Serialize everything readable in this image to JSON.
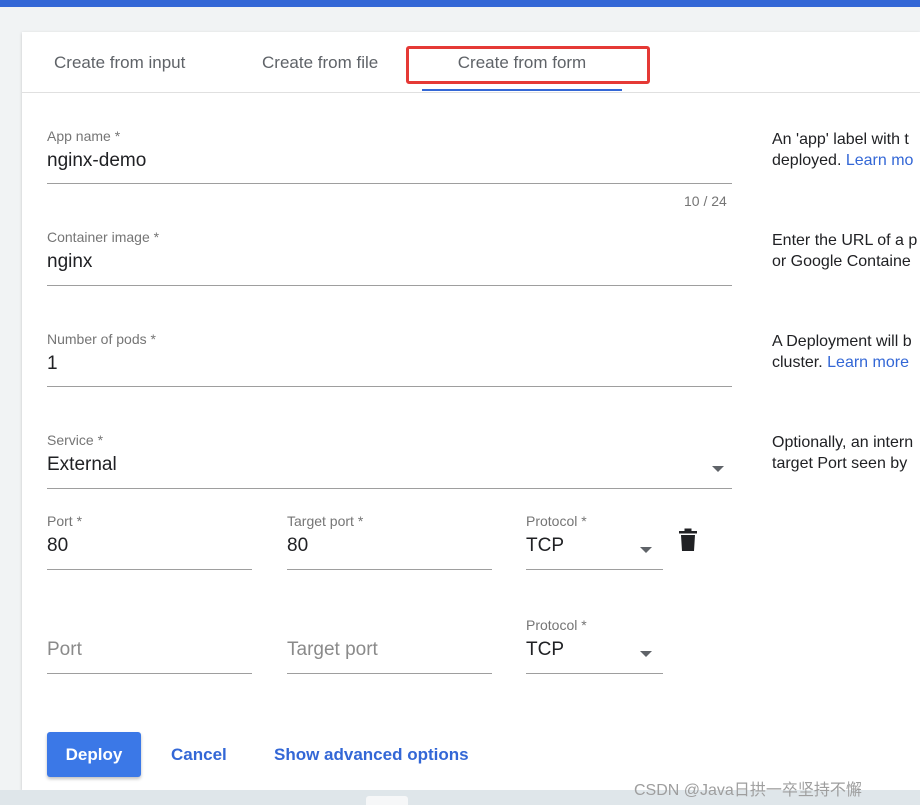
{
  "tabs": [
    {
      "label": "Create from input"
    },
    {
      "label": "Create from file"
    },
    {
      "label": "Create from form",
      "selected": true
    }
  ],
  "form": {
    "app_name": {
      "label": "App name *",
      "value": "nginx-demo",
      "counter": "10 / 24"
    },
    "container_image": {
      "label": "Container image *",
      "value": "nginx"
    },
    "pods": {
      "label": "Number of pods *",
      "value": "1"
    },
    "service": {
      "label": "Service *",
      "value": "External"
    },
    "port_rows": [
      {
        "port_label": "Port *",
        "port": "80",
        "target_label": "Target port *",
        "target": "80",
        "protocol_label": "Protocol *",
        "protocol": "TCP"
      },
      {
        "port_placeholder": "Port",
        "target_placeholder": "Target port",
        "protocol_label": "Protocol *",
        "protocol": "TCP"
      }
    ]
  },
  "help": {
    "app_name": {
      "line1": "An 'app' label with t",
      "line2": "deployed. ",
      "link": "Learn mo"
    },
    "container_image": {
      "line1": "Enter the URL of a p",
      "line2": "or Google Containe"
    },
    "pods": {
      "line1": "A Deployment will b",
      "line2": "cluster. ",
      "link": "Learn more"
    },
    "service": {
      "line1": "Optionally, an intern",
      "line2": "target Port seen by"
    }
  },
  "actions": {
    "deploy": "Deploy",
    "cancel": "Cancel",
    "advanced": "Show advanced options"
  },
  "watermark": "CSDN @Java日拱一卒坚持不懈",
  "colors": {
    "accent": "#3367d6",
    "highlight": "#e53935",
    "deploy_bg": "#3b78e7"
  }
}
